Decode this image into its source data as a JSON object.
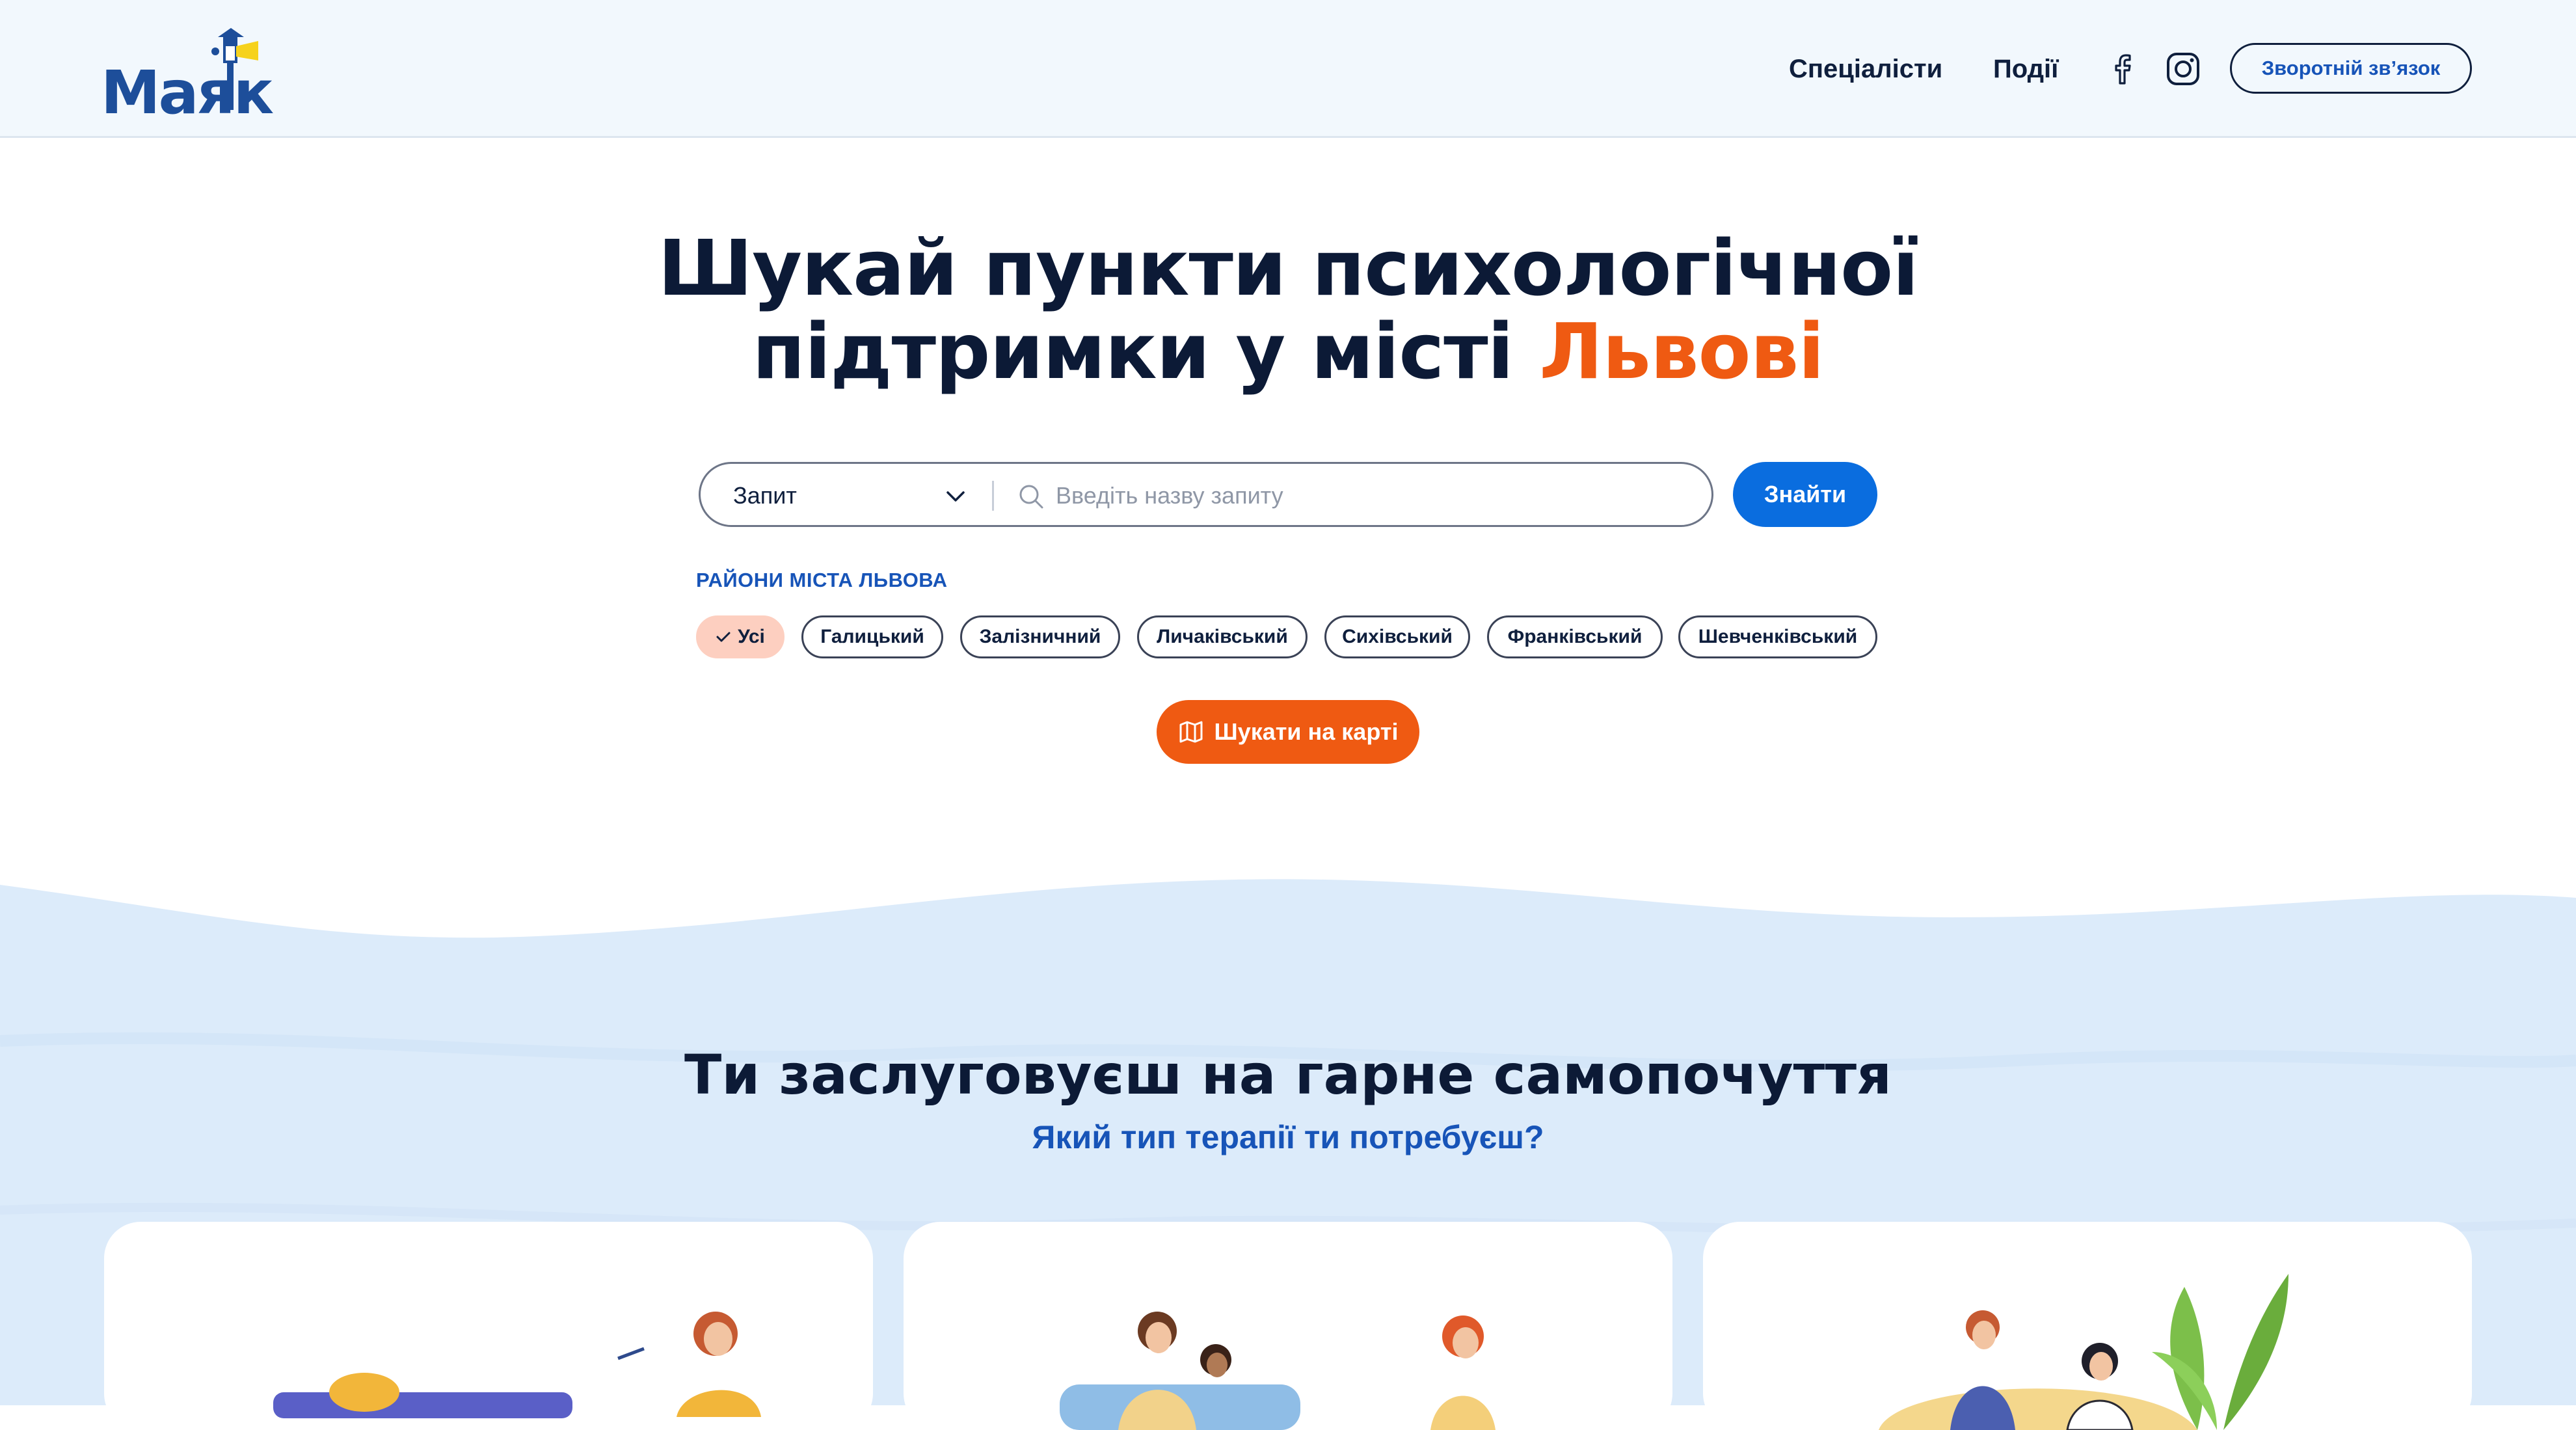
{
  "header": {
    "logo_text": "Маяк",
    "nav": [
      {
        "label": "Спеціалісти"
      },
      {
        "label": "Події"
      }
    ],
    "social": [
      "facebook-icon",
      "instagram-icon"
    ],
    "contact_label": "Зворотній зв’язок"
  },
  "hero": {
    "title_line1": "Шукай пункти психологічної",
    "title_line2_prefix": "підтримки у місті ",
    "title_city": "Львові"
  },
  "search": {
    "select_value": "Запит",
    "placeholder": "Введіть назву запиту",
    "find_label": "Знайти"
  },
  "districts": {
    "label": "РАЙОНИ МІСТА ЛЬВОВА",
    "items": [
      {
        "label": "Усі",
        "selected": true
      },
      {
        "label": "Галицький",
        "selected": false
      },
      {
        "label": "Залізничний",
        "selected": false
      },
      {
        "label": "Личаківський",
        "selected": false
      },
      {
        "label": "Сихівський",
        "selected": false
      },
      {
        "label": "Франківський",
        "selected": false
      },
      {
        "label": "Шевченківський",
        "selected": false
      }
    ]
  },
  "map_button_label": "Шукати на карті",
  "therapy": {
    "title": "Ти заслуговуєш на гарне самопочуття",
    "subtitle": "Який тип терапії ти потребуєш?"
  },
  "colors": {
    "accent_orange": "#ef5a12",
    "primary_blue": "#0a6ddf",
    "navy": "#0c1a36",
    "chip_selected": "#fdcfc0",
    "wave_blue": "#dcebfa"
  }
}
